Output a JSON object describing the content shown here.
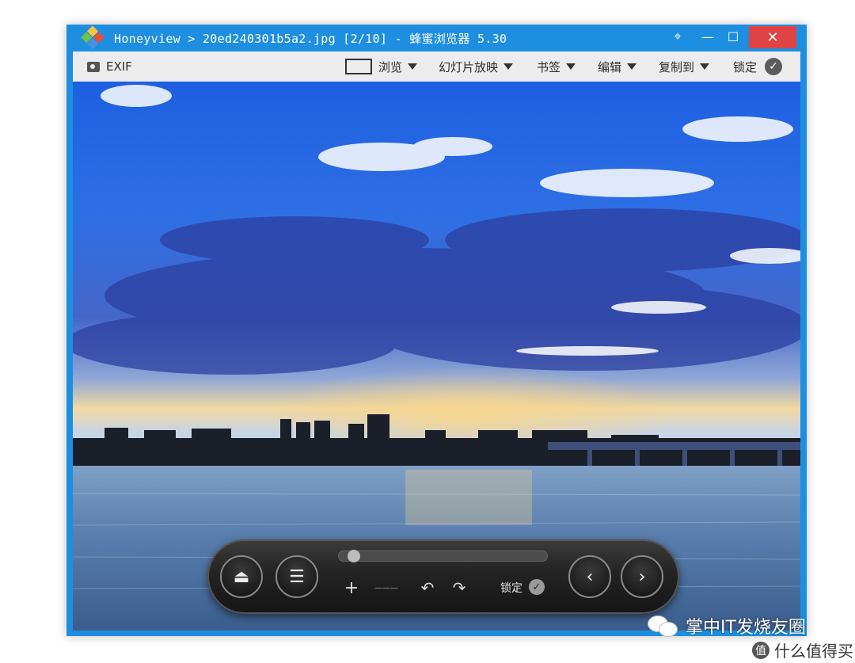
{
  "window": {
    "title": "Honeyview > 20ed240301b5a2.jpg [2/10] - 蜂蜜浏览器 5.30",
    "controls": {
      "pin": "⌖",
      "minimize": "—",
      "maximize": "☐",
      "close": "✕"
    }
  },
  "toolbar": {
    "exif_label": "EXIF",
    "browse_label": "浏览",
    "slideshow_label": "幻灯片放映",
    "bookmark_label": "书签",
    "edit_label": "编辑",
    "copy_label": "复制到",
    "lock_label": "锁定",
    "lock_check": "✓"
  },
  "controls": {
    "eject": "⏏",
    "menu": "☰",
    "prev": "‹",
    "next": "›",
    "zoom_in": "+",
    "zoom_out_line": "———",
    "rotate_left": "↶",
    "rotate_right": "↷",
    "lock_label": "锁定",
    "lock_check": "✓",
    "slider_position": 0.05
  },
  "watermark": {
    "text": "掌中IT发烧友圈",
    "icon": "wechat-icon"
  },
  "badge": {
    "icon": "值",
    "text": "什么值得买"
  },
  "colors": {
    "window_accent": "#1e8fe0",
    "close_button": "#e04343",
    "toolbar_bg": "#ececec"
  }
}
